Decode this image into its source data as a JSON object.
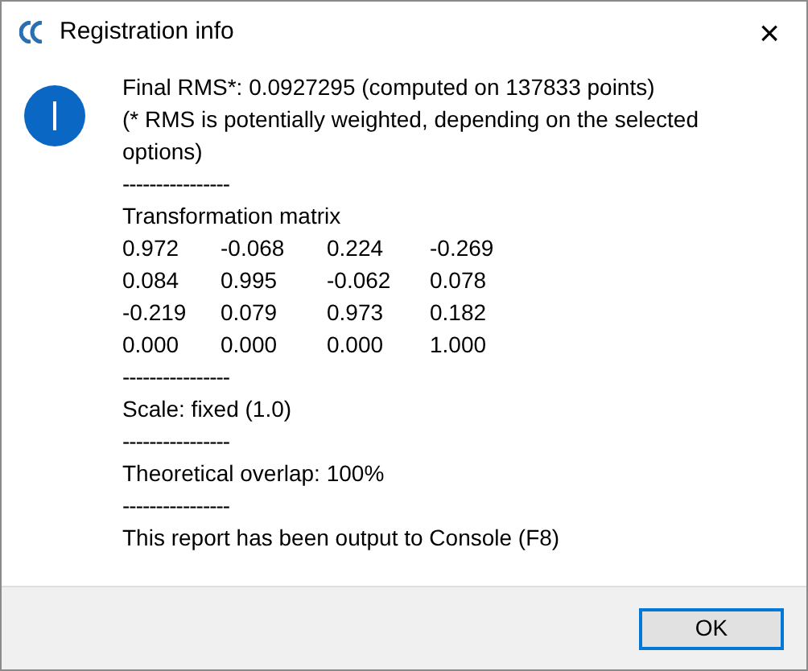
{
  "window": {
    "title": "Registration info",
    "close": "×"
  },
  "report": [
    {
      "kind": "text",
      "text": "Final RMS*: 0.0927295 (computed on 137833 points)"
    },
    {
      "kind": "text",
      "text": "(* RMS is potentially weighted, depending on the selected options)"
    },
    {
      "kind": "separator",
      "text": "----------------"
    },
    {
      "kind": "text",
      "text": "Transformation matrix"
    },
    {
      "kind": "matrix_row",
      "cells": [
        "0.972",
        "-0.068",
        "0.224",
        "-0.269"
      ]
    },
    {
      "kind": "matrix_row",
      "cells": [
        "0.084",
        "0.995",
        "-0.062",
        "0.078"
      ]
    },
    {
      "kind": "matrix_row",
      "cells": [
        "-0.219",
        "0.079",
        "0.973",
        "0.182"
      ]
    },
    {
      "kind": "matrix_row",
      "cells": [
        "0.000",
        "0.000",
        "0.000",
        "1.000"
      ]
    },
    {
      "kind": "separator",
      "text": "----------------"
    },
    {
      "kind": "text",
      "text": "Scale: fixed (1.0)"
    },
    {
      "kind": "separator",
      "text": "----------------"
    },
    {
      "kind": "text",
      "text": "Theoretical overlap: 100%"
    },
    {
      "kind": "separator",
      "text": "----------------"
    },
    {
      "kind": "text",
      "text": "This report has been output to Console (F8)"
    }
  ],
  "buttons": [
    {
      "label": "OK",
      "selected": true
    }
  ]
}
